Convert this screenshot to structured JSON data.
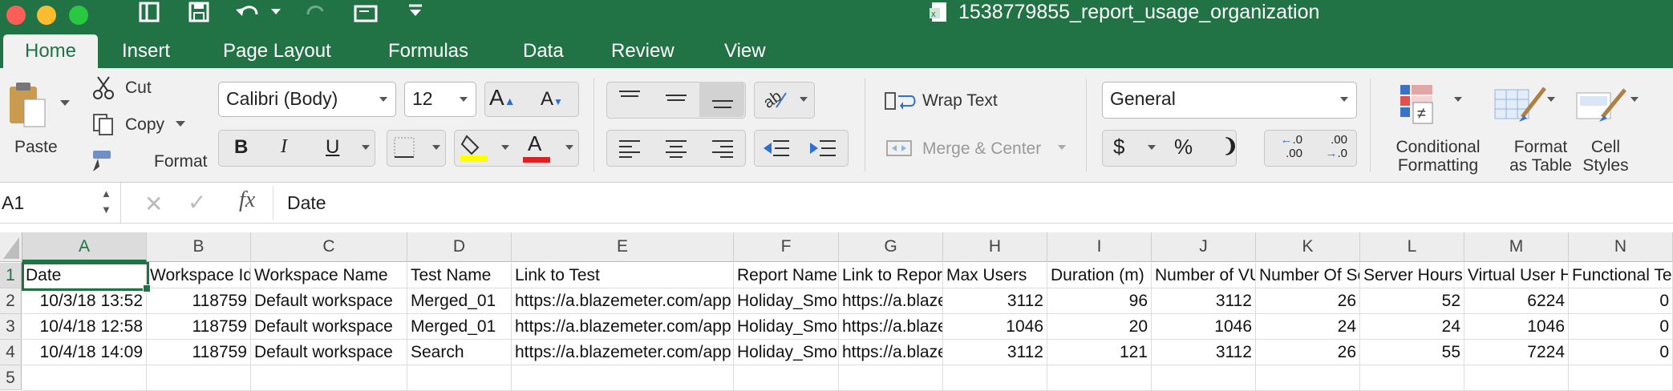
{
  "window": {
    "title": "1538779855_report_usage_organization"
  },
  "tabs": [
    "Home",
    "Insert",
    "Page Layout",
    "Formulas",
    "Data",
    "Review",
    "View"
  ],
  "ribbon": {
    "paste": "Paste",
    "cut": "Cut",
    "copy": "Copy",
    "format": "Format",
    "font_name": "Calibri (Body)",
    "font_size": "12",
    "wrap_text": "Wrap Text",
    "merge_center": "Merge & Center",
    "number_format": "General",
    "conditional_formatting": [
      "Conditional",
      "Formatting"
    ],
    "format_as_table": [
      "Format",
      "as Table"
    ],
    "cell_styles": [
      "Cell",
      "Styles"
    ],
    "bold": "B",
    "italic": "I",
    "underline": "U",
    "font_color_letter": "A",
    "dollar": "$",
    "percent": "%",
    "comma": "❩",
    "inc_decimal": [
      ".0",
      ".00"
    ],
    "dec_decimal": [
      ".00",
      ".0"
    ]
  },
  "formula_bar": {
    "name_box": "A1",
    "fx": "fx",
    "content": "Date"
  },
  "colors": {
    "excel_green": "#217346"
  },
  "sheet": {
    "columns": [
      "A",
      "B",
      "C",
      "D",
      "E",
      "F",
      "G",
      "H",
      "I",
      "J",
      "K",
      "L",
      "M",
      "N"
    ],
    "rows": [
      "1",
      "2",
      "3",
      "4",
      "5"
    ],
    "header_row": [
      "Date",
      "Workspace Id",
      "Workspace Name",
      "Test Name",
      "Link to Test",
      "Report Name",
      "Link to Report",
      "Max Users",
      "Duration (m)",
      "Number of VUs",
      "Number Of Sessions",
      "Server Hours",
      "Virtual User Hours",
      "Functional Tests"
    ],
    "data_rows": [
      [
        "10/3/18 13:52",
        "118759",
        "Default workspace",
        "Merged_01",
        "https://a.blazemeter.com/app",
        "Holiday_Smoke",
        "https://a.blazemeter",
        "3112",
        "96",
        "3112",
        "26",
        "52",
        "6224",
        "0"
      ],
      [
        "10/4/18 12:58",
        "118759",
        "Default workspace",
        "Merged_01",
        "https://a.blazemeter.com/app",
        "Holiday_Smoke",
        "https://a.blazemeter",
        "1046",
        "20",
        "1046",
        "24",
        "24",
        "1046",
        "0"
      ],
      [
        "10/4/18 14:09",
        "118759",
        "Default workspace",
        "Search",
        "https://a.blazemeter.com/app",
        "Holiday_Smoke",
        "https://a.blazemeter",
        "3112",
        "121",
        "3112",
        "26",
        "55",
        "7224",
        "0"
      ]
    ],
    "selected_cell": "A1"
  }
}
